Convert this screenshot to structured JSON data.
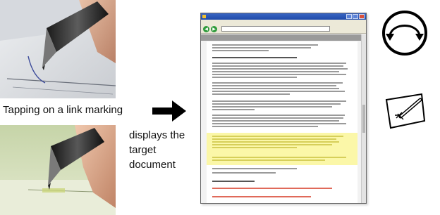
{
  "captions": {
    "main": "Tapping on a link marking",
    "sub_lines": [
      "displays the",
      "target",
      "document"
    ]
  },
  "icons": {
    "arrow": "arrow-right-icon",
    "back": "rotate-back-icon",
    "edit": "pen-on-paper-icon"
  },
  "colors": {
    "highlight": "#fbf7a8",
    "titlebar": "#1e49a8",
    "link_text": "#e06a5a"
  }
}
